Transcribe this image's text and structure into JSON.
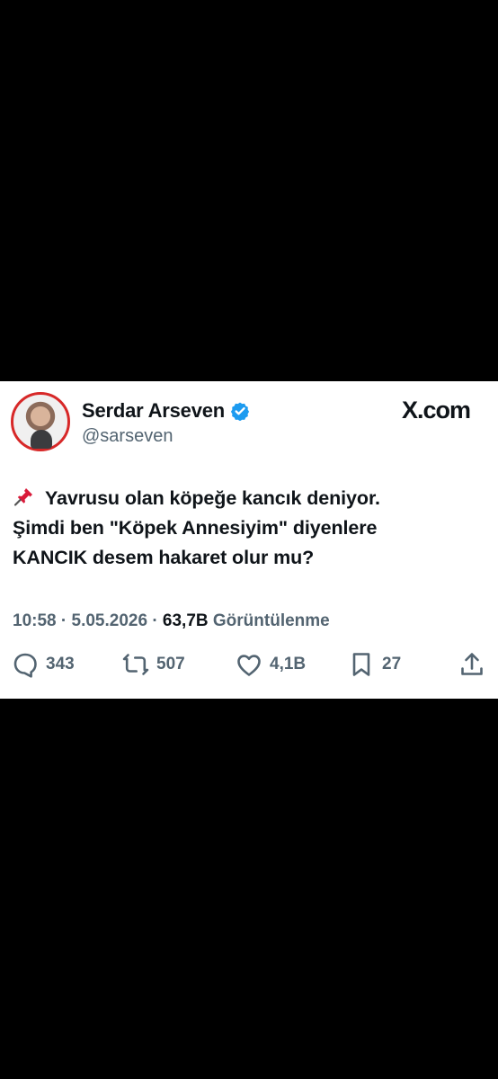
{
  "tweet": {
    "author": {
      "name": "Serdar Arseven",
      "handle": "@sarseven",
      "verified": true
    },
    "source": "X.com",
    "text_lines": [
      "Yavrusu olan köpeğe kancık deniyor.",
      "Şimdi ben \"Köpek Annesiyim\" diyenlere",
      "KANCIK desem hakaret olur mu?"
    ],
    "time": "10:58",
    "date": "5.05.2026",
    "views": "63,7B",
    "views_label": "Görüntülenme",
    "separator": "·",
    "stats": {
      "replies": "343",
      "reposts": "507",
      "likes": "4,1B",
      "bookmarks": "27"
    }
  }
}
